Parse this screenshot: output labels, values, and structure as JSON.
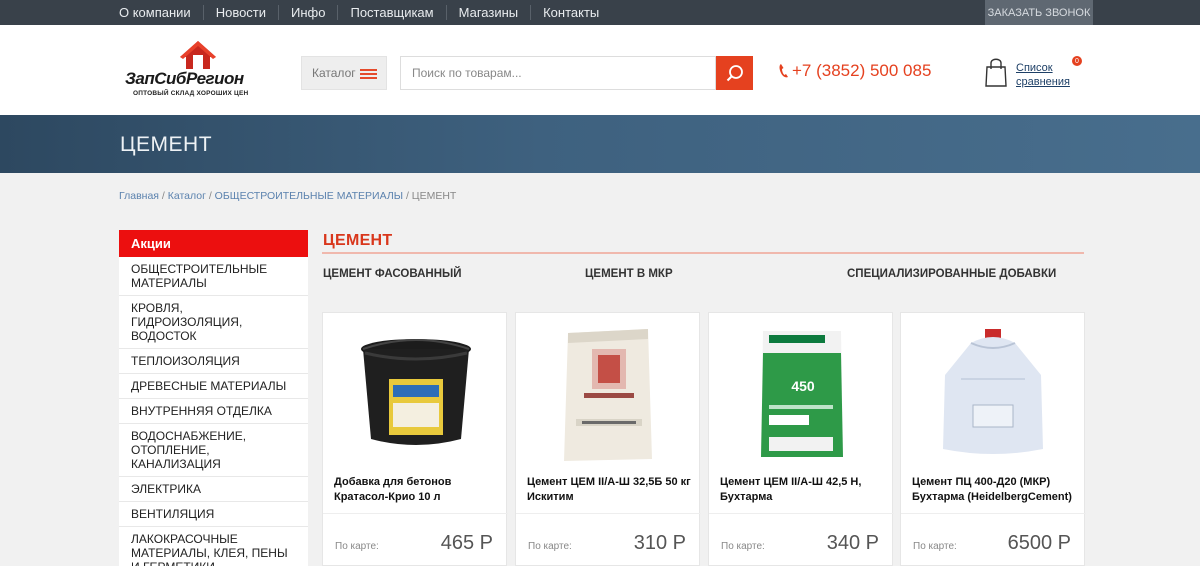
{
  "topnav": {
    "items": [
      "О компании",
      "Новости",
      "Инфо",
      "Поставщикам",
      "Магазины",
      "Контакты"
    ],
    "callback": "ЗАКАЗАТЬ ЗВОНОК"
  },
  "header": {
    "logo_text": "ЗапСибРегион",
    "logo_tagline": "ОПТОВЫЙ СКЛАД ХОРОШИХ ЦЕН",
    "catalog_label": "Каталог",
    "search_placeholder": "Поиск по товарам...",
    "phone": "+7 (3852) 500 085",
    "compare_label_1": "Список",
    "compare_label_2": "сравнения",
    "compare_count": "0",
    "accent_color": "#e5411f"
  },
  "banner": {
    "title": "ЦЕМЕНТ"
  },
  "breadcrumb": {
    "items": [
      "Главная",
      "Каталог",
      "ОБЩЕСТРОИТЕЛЬНЫЕ МАТЕРИАЛЫ"
    ],
    "current": "ЦЕМЕНТ"
  },
  "sidebar": {
    "promo": "Акции",
    "items": [
      "ОБЩЕСТРОИТЕЛЬНЫЕ МАТЕРИАЛЫ",
      "КРОВЛЯ, ГИДРОИЗОЛЯЦИЯ, ВОДОСТОК",
      "ТЕПЛОИЗОЛЯЦИЯ",
      "ДРЕВЕСНЫЕ МАТЕРИАЛЫ",
      "ВНУТРЕННЯЯ ОТДЕЛКА",
      "ВОДОСНАБЖЕНИЕ, ОТОПЛЕНИЕ, КАНАЛИЗАЦИЯ",
      "ЭЛЕКТРИКА",
      "ВЕНТИЛЯЦИЯ",
      "ЛАКОКРАСОЧНЫЕ МАТЕРИАЛЫ, КЛЕЯ, ПЕНЫ И ГЕРМЕТИКИ"
    ]
  },
  "main": {
    "title": "ЦЕМЕНТ",
    "subcategories": [
      "ЦЕМЕНТ ФАСОВАННЫЙ",
      "ЦЕМЕНТ В МКР",
      "СПЕЦИАЛИЗИРОВАННЫЕ ДОБАВКИ"
    ],
    "products": [
      {
        "name": "Добавка для бетонов Кратасол-Крио 10 л",
        "price_label": "По карте:",
        "price": "465 Р",
        "image": "bucket-image"
      },
      {
        "name": "Цемент ЦЕМ II/А-Ш 32,5Б 50 кг Искитим",
        "price_label": "По карте:",
        "price": "310 Р",
        "image": "cement-bag-image"
      },
      {
        "name": "Цемент ЦЕМ II/А-Ш 42,5 Н, Бухтарма",
        "price_label": "По карте:",
        "price": "340 Р",
        "image": "green-bag-image"
      },
      {
        "name": "Цемент ПЦ 400-Д20 (МКР) Бухтарма (HeidelbergCement)",
        "price_label": "По карте:",
        "price": "6500 Р",
        "image": "big-bag-image"
      }
    ]
  }
}
